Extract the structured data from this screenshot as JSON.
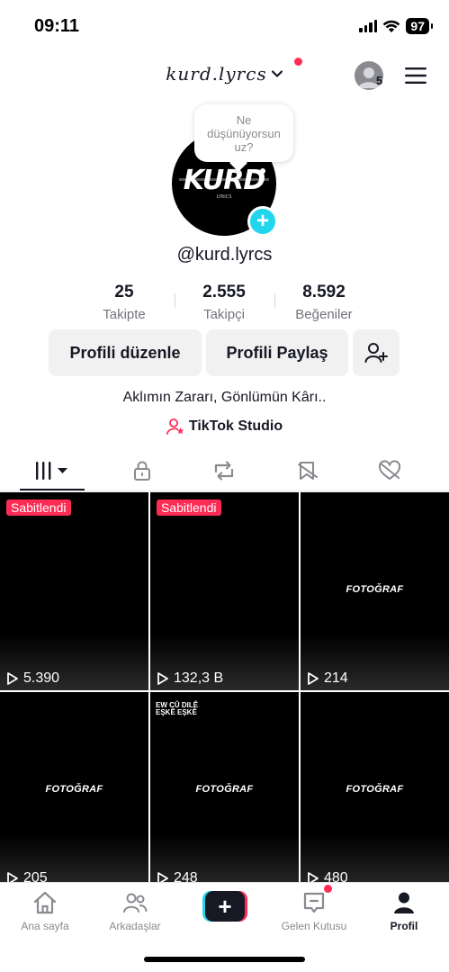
{
  "status_bar": {
    "time": "09:11",
    "battery": "97"
  },
  "header": {
    "title": "kurd.lyrcs",
    "account_count": "5"
  },
  "profile": {
    "bubble_lines": [
      "Ne",
      "düşünüyorsun",
      "uz?"
    ],
    "handle": "@kurd.lyrcs",
    "avatar_text": "KURD",
    "avatar_subtext": "LYRICS",
    "stats": [
      {
        "value": "25",
        "label": "Takipte"
      },
      {
        "value": "2.555",
        "label": "Takipçi"
      },
      {
        "value": "8.592",
        "label": "Beğeniler"
      }
    ],
    "edit_label": "Profili düzenle",
    "share_label": "Profili Paylaş",
    "bio": "Aklımın Zararı, Gönlümün Kârı..",
    "studio_label": "TikTok Studio"
  },
  "tabs": [
    "videos-tab",
    "private-tab",
    "reposts-tab",
    "favorites-tab",
    "liked-tab"
  ],
  "videos": [
    {
      "pinned": "Sabitlendi",
      "views": "5.390",
      "caption": ""
    },
    {
      "pinned": "Sabitlendi",
      "views": "132,3 B",
      "caption": ""
    },
    {
      "pinned": "",
      "views": "214",
      "caption": "FOTOĞRAF"
    },
    {
      "pinned": "",
      "views": "205",
      "caption": "FOTOĞRAF"
    },
    {
      "pinned": "",
      "views": "248",
      "caption": "FOTOĞRAF",
      "overlay": [
        "EW CÛ DILÊ",
        "EŞKÊ EŞKÊ"
      ]
    },
    {
      "pinned": "",
      "views": "480",
      "caption": "FOTOĞRAF"
    }
  ],
  "bottom_nav": [
    {
      "label": "Ana sayfa",
      "icon": "home-icon"
    },
    {
      "label": "Arkadaşlar",
      "icon": "friends-icon"
    },
    {
      "label": "",
      "icon": "create-icon"
    },
    {
      "label": "Gelen Kutusu",
      "icon": "inbox-icon"
    },
    {
      "label": "Profil",
      "icon": "profile-icon"
    }
  ],
  "colors": {
    "accent": "#fe2c55",
    "cyan": "#20d5ec",
    "text": "#161823",
    "muted": "#8a8b91"
  }
}
